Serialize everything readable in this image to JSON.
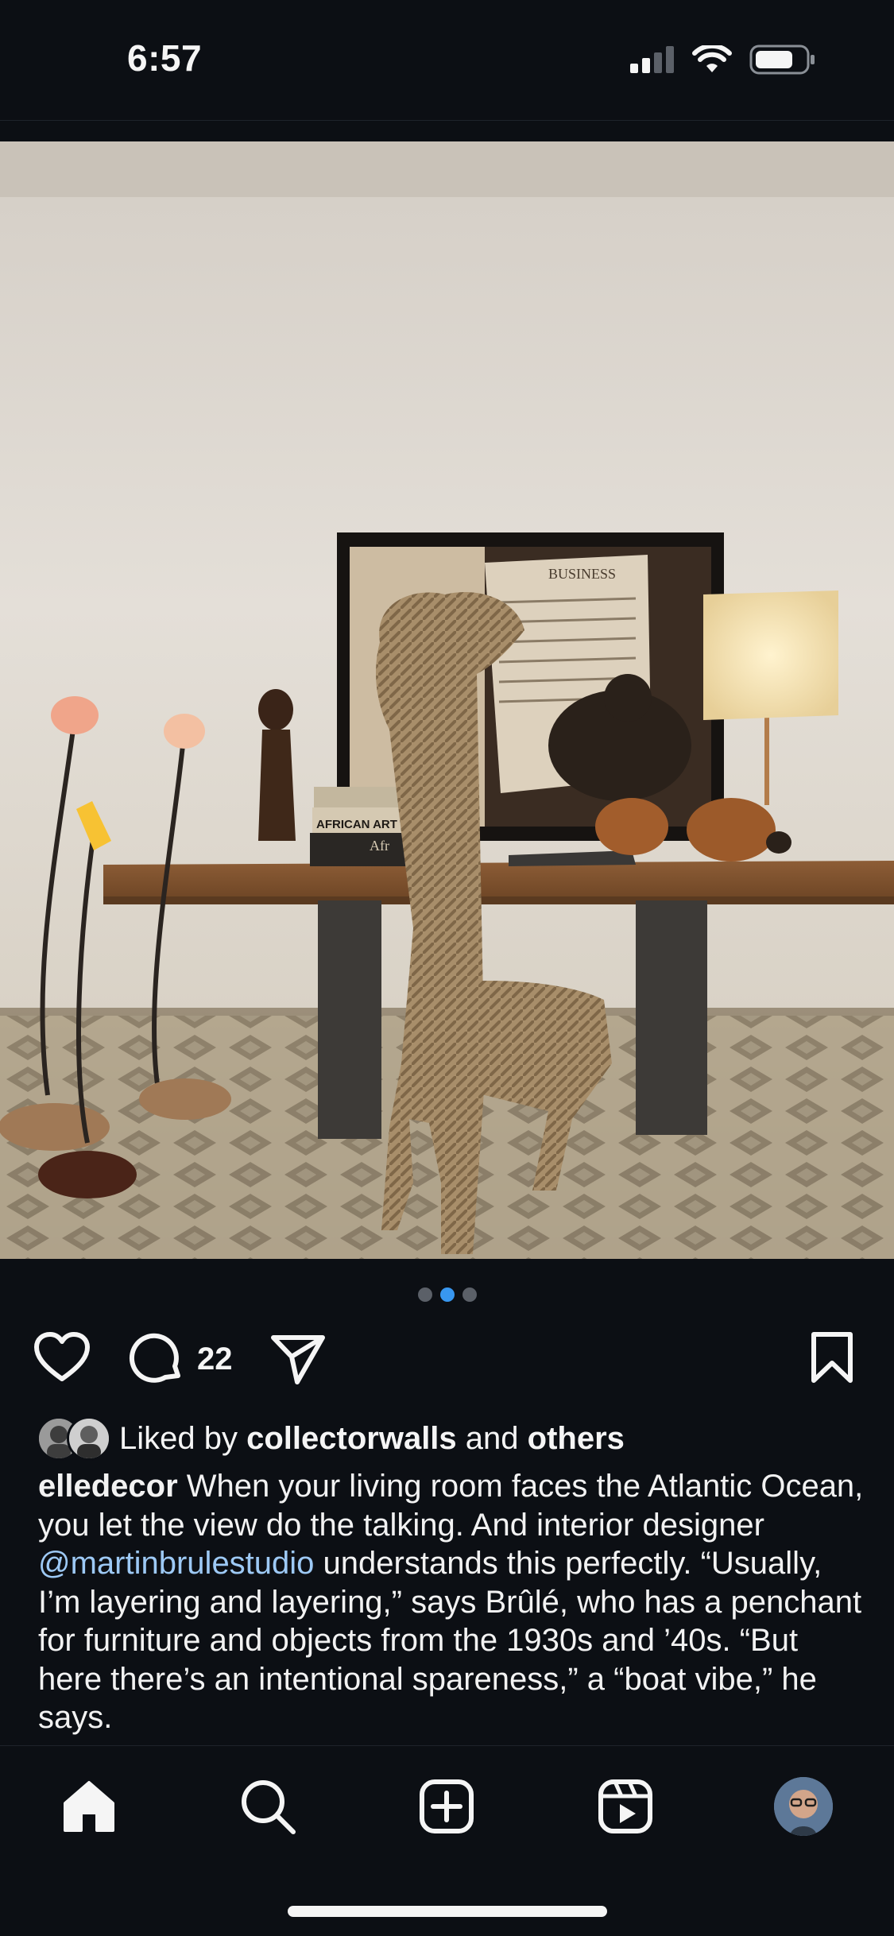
{
  "status_bar": {
    "time": "6:57"
  },
  "post": {
    "pager": {
      "count": 3,
      "active_index": 1
    },
    "actions": {
      "comment_count": "22"
    },
    "likes": {
      "prefix": "Liked by ",
      "user": "collectorwalls",
      "middle": " and ",
      "others": "others"
    },
    "caption": {
      "username": "elledecor",
      "text_part1": " When your living room faces the Atlantic Ocean, you let the view do the talking. And interior designer ",
      "mention": "@martinbrulestudio",
      "text_part2": " understands this perfectly. “Usually, I’m layering and layering,” says Brûlé, who has a penchant for furniture and objects from the 1930s and ’40s. “But here there’s an intentional spareness,” a “boat vibe,” he says."
    },
    "image": {
      "book_spine_1": "AFRICAN ART",
      "book_spine_2": "Afr",
      "newspaper_header": "BUSINESS"
    }
  },
  "tab_bar": {
    "items": [
      "home-icon",
      "search-icon",
      "create-icon",
      "reels-icon",
      "profile-avatar"
    ]
  },
  "colors": {
    "background": "#0c0f14",
    "accent": "#3897f0",
    "mention": "#9dc9f5"
  }
}
